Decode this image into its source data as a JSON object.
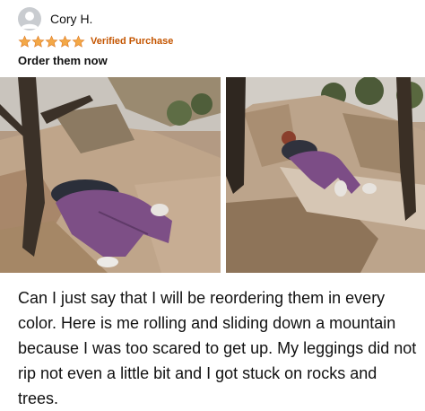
{
  "review": {
    "reviewer_name": "Cory H.",
    "rating": 5,
    "rating_max": 5,
    "badge": "Verified Purchase",
    "title": "Order them now",
    "body": "Can I just say that I will be reordering them in every color. Here is me rolling and sliding down a mountain because I was too scared to get up. My leggings did not rip not even a little bit and I got stuck on rocks and trees.",
    "star_color": "#f3a847",
    "badge_color": "#c45500"
  },
  "icons": {
    "avatar": "user-avatar-icon",
    "star": "star-icon"
  }
}
